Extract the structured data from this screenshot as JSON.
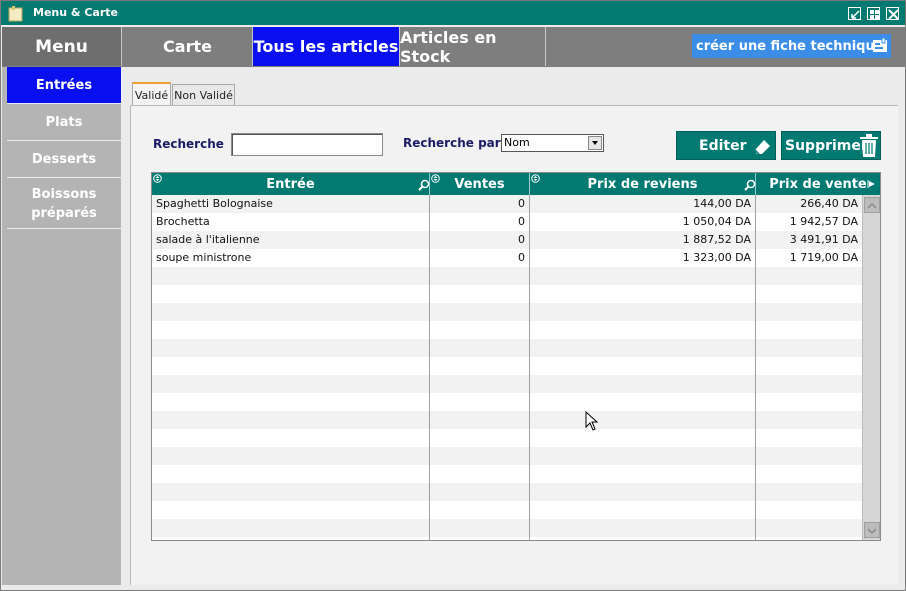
{
  "window": {
    "title": "Menu & Carte"
  },
  "nav": {
    "tabs": [
      {
        "label": "Menu"
      },
      {
        "label": "Carte"
      },
      {
        "label": "Tous les articles"
      },
      {
        "label": "Articles en Stock"
      }
    ],
    "create_label": "créer une fiche technique"
  },
  "sidebar": {
    "items": [
      {
        "label": "Entrées"
      },
      {
        "label": "Plats"
      },
      {
        "label": "Desserts"
      },
      {
        "label": "Boissons préparés"
      }
    ]
  },
  "subtabs": [
    {
      "label": "Validé"
    },
    {
      "label": "Non Validé"
    }
  ],
  "search": {
    "label": "Recherche",
    "value": "",
    "by_label": "Recherche par :",
    "by_value": "Nom"
  },
  "buttons": {
    "edit": "Editer",
    "delete": "Supprimer"
  },
  "table": {
    "columns": [
      "Entrée",
      "Ventes",
      "Prix de reviens",
      "Prix de vente"
    ],
    "rows": [
      [
        "Spaghetti Bolognaise",
        "0",
        "144,00 DA",
        "266,40 DA"
      ],
      [
        "Brochetta",
        "0",
        "1 050,04 DA",
        "1 942,57 DA"
      ],
      [
        "salade à l'italienne",
        "0",
        "1 887,52 DA",
        "3 491,91 DA"
      ],
      [
        "soupe ministrone",
        "0",
        "1 323,00 DA",
        "1 719,00 DA"
      ]
    ]
  },
  "colors": {
    "teal": "#027a72",
    "active_blue": "#0a0ff0",
    "create_blue": "#3b8de8"
  },
  "icons": [
    "app-icon",
    "minimize-icon",
    "maximize-icon",
    "close-icon",
    "document-icon",
    "eraser-icon",
    "trash-icon",
    "search-icon",
    "sort-icon",
    "column-menu-icon",
    "mouse-cursor-icon"
  ]
}
